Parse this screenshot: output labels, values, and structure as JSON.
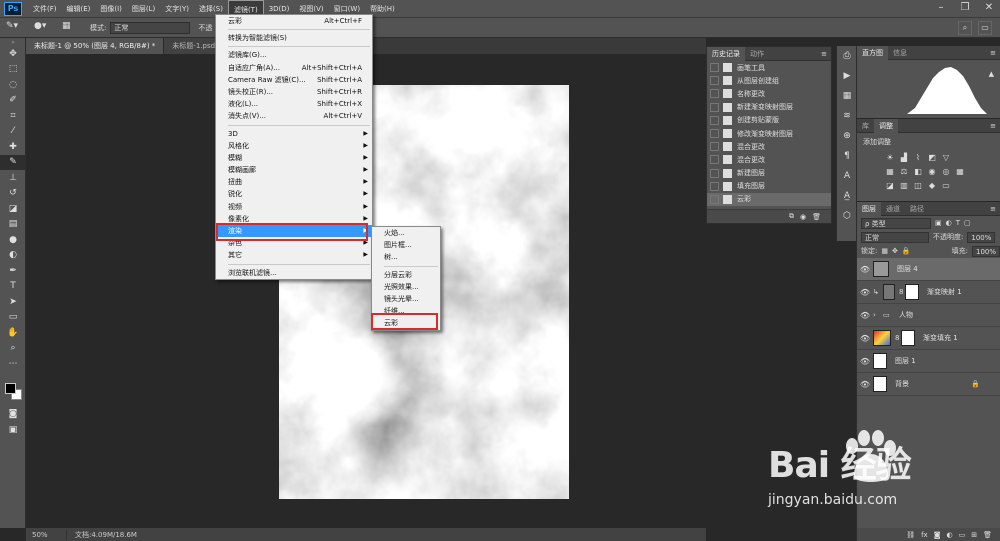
{
  "menubar": {
    "logo": "Ps",
    "items": [
      "文件(F)",
      "编辑(E)",
      "图像(I)",
      "图层(L)",
      "文字(Y)",
      "选择(S)",
      "滤镜(T)",
      "3D(D)",
      "视图(V)",
      "窗口(W)",
      "帮助(H)"
    ],
    "active_index": 6
  },
  "optbar": {
    "mode_label": "模式:",
    "mode_value": "正常",
    "extra": "不透"
  },
  "tabs": [
    "未标题-1 @ 50% (图层 4, RGB/8#) *",
    "未标题-1.psd @"
  ],
  "filter_menu": {
    "items": [
      {
        "label": "云彩",
        "shortcut": "Alt+Ctrl+F"
      },
      {
        "sep": true
      },
      {
        "label": "转换为智能滤镜(S)"
      },
      {
        "sep": true
      },
      {
        "label": "滤镜库(G)..."
      },
      {
        "label": "自适应广角(A)...",
        "shortcut": "Alt+Shift+Ctrl+A"
      },
      {
        "label": "Camera Raw 滤镜(C)...",
        "shortcut": "Shift+Ctrl+A"
      },
      {
        "label": "镜头校正(R)...",
        "shortcut": "Shift+Ctrl+R"
      },
      {
        "label": "液化(L)...",
        "shortcut": "Shift+Ctrl+X"
      },
      {
        "label": "消失点(V)...",
        "shortcut": "Alt+Ctrl+V"
      },
      {
        "sep": true
      },
      {
        "label": "3D",
        "sub": true
      },
      {
        "label": "风格化",
        "sub": true
      },
      {
        "label": "模糊",
        "sub": true
      },
      {
        "label": "模糊画廊",
        "sub": true
      },
      {
        "label": "扭曲",
        "sub": true
      },
      {
        "label": "锐化",
        "sub": true
      },
      {
        "label": "视频",
        "sub": true
      },
      {
        "label": "像素化",
        "sub": true
      },
      {
        "label": "渲染",
        "sub": true,
        "highlight": true
      },
      {
        "label": "杂色",
        "sub": true
      },
      {
        "label": "其它",
        "sub": true
      },
      {
        "sep": true
      },
      {
        "label": "浏览联机滤镜..."
      }
    ]
  },
  "render_submenu": {
    "items": [
      {
        "label": "火焰..."
      },
      {
        "label": "图片框..."
      },
      {
        "label": "树..."
      },
      {
        "sep": true
      },
      {
        "label": "分层云彩"
      },
      {
        "label": "光照效果..."
      },
      {
        "label": "镜头光晕..."
      },
      {
        "label": "纤维..."
      },
      {
        "label": "云彩",
        "boxed": true
      }
    ]
  },
  "history": {
    "tabs": [
      "历史记录",
      "动作"
    ],
    "items": [
      "画笔工具",
      "从图层创建组",
      "名称更改",
      "新建渐变映射图层",
      "创建剪贴蒙版",
      "修改渐变映射图层",
      "混合更改",
      "混合更改",
      "新建图层",
      "填充图层",
      "云彩"
    ]
  },
  "histogram": {
    "tabs": [
      "直方图",
      "信息"
    ]
  },
  "adjustments": {
    "tabs": [
      "库",
      "调整"
    ],
    "title": "添加调整"
  },
  "layers": {
    "tabs": [
      "图层",
      "通道",
      "路径"
    ],
    "filter": "ρ 类型",
    "blend": "正常",
    "opacity_label": "不透明度:",
    "opacity": "100%",
    "lock_label": "锁定:",
    "fill_label": "填充:",
    "fill": "100%",
    "items": [
      "图层 4",
      "渐变映射 1",
      "人物",
      "渐变填充 1",
      "图层 1",
      "背景"
    ]
  },
  "status": {
    "zoom": "50%",
    "doc": "文档:4.09M/18.6M"
  },
  "watermark": {
    "brand": "Bai 经验",
    "url": "jingyan.baidu.com"
  }
}
